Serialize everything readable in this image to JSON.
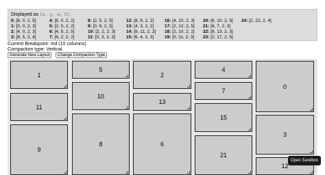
{
  "layout_panel": {
    "title_prefix": "Displayed as",
    "title_code": "[x, y, w, h]:",
    "columns": [
      [
        {
          "key": "0:",
          "val": "[8, 0, 2, 5]"
        },
        {
          "key": "1:",
          "val": "[0, 0, 2, 3]"
        },
        {
          "key": "2:",
          "val": "[4, 0, 2, 3]"
        },
        {
          "key": "3:",
          "val": "[8, 5, 2, 4]"
        }
      ],
      [
        {
          "key": "4:",
          "val": "[6, 0, 2, 2]"
        },
        {
          "key": "5:",
          "val": "[2, 0, 2, 2]"
        },
        {
          "key": "6:",
          "val": "[4, 5, 2, 5]"
        },
        {
          "key": "7:",
          "val": "[6, 2, 2, 2]"
        }
      ],
      [
        {
          "key": "8:",
          "val": "[2, 5, 2, 5]"
        },
        {
          "key": "9:",
          "val": "[0, 6, 2, 5]"
        },
        {
          "key": "10:",
          "val": "[2, 2, 2, 3]"
        },
        {
          "key": "11:",
          "val": "[0, 3, 2, 3]"
        }
      ],
      [
        {
          "key": "12:",
          "val": "[8, 9, 2, 2]"
        },
        {
          "key": "13:",
          "val": "[4, 3, 2, 2]"
        },
        {
          "key": "14:",
          "val": "[8, 11, 2, 2]"
        },
        {
          "key": "15:",
          "val": "[6, 4, 2, 3]"
        }
      ],
      [
        {
          "key": "16:",
          "val": "[4, 10, 2, 3]"
        },
        {
          "key": "17:",
          "val": "[2, 12, 2, 5]"
        },
        {
          "key": "18:",
          "val": "[2, 10, 2, 2]"
        },
        {
          "key": "19:",
          "val": "[0, 11, 2, 3]"
        }
      ],
      [
        {
          "key": "20:",
          "val": "[6, 10, 2, 5]"
        },
        {
          "key": "21:",
          "val": "[6, 7, 2, 3]"
        },
        {
          "key": "22:",
          "val": "[8, 13, 2, 3]"
        },
        {
          "key": "23:",
          "val": "[2, 17, 2, 5]"
        }
      ],
      [
        {
          "key": "24:",
          "val": "[2, 22, 2, 4]"
        }
      ]
    ]
  },
  "breakpoint_text": "Current Breakpoint: md (10 columns)",
  "compaction_text": "Compaction type: Vertical",
  "buttons": {
    "generate": "Generate New Layout",
    "change_compaction": "Change Compaction Type"
  },
  "grid_items": [
    "1",
    "5",
    "2",
    "4",
    "0",
    "10",
    "7",
    "11",
    "13",
    "15",
    "3",
    "9",
    "8",
    "6",
    "21",
    "12"
  ],
  "open_sandbox": "Open Sandbox"
}
